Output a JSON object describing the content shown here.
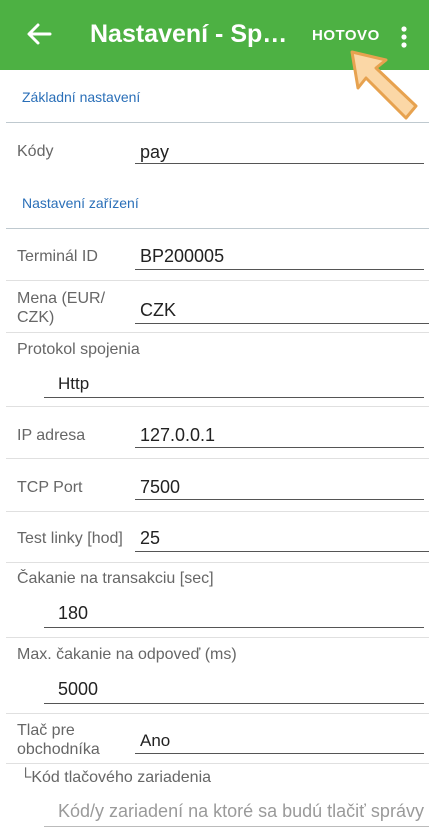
{
  "appbar": {
    "back_icon": "arrow-left-icon",
    "title": "Nastavení - Správ...",
    "done_label": "HOTOVO",
    "more_icon": "more-vertical-icon",
    "color": "#4db143"
  },
  "sections": {
    "basic": "Základní nastavení",
    "device": "Nastavení zařízení"
  },
  "fields": {
    "codes": {
      "label": "Kódy",
      "value": "pay"
    },
    "terminal_id": {
      "label": "Terminál ID",
      "value": "BP200005"
    },
    "currency": {
      "label": "Mena (EUR/\nCZK)",
      "value": "CZK"
    },
    "protocol": {
      "label": "Protokol spojenia",
      "value": "Http"
    },
    "ip": {
      "label": "IP adresa",
      "value": "127.0.0.1"
    },
    "tcp_port": {
      "label": "TCP Port",
      "value": "7500"
    },
    "test_line": {
      "label": "Test linky [hod]",
      "value": "25"
    },
    "tx_wait": {
      "label": "Čakanie na transakciu [sec]",
      "value": "180"
    },
    "max_wait": {
      "label": "Max. čakanie na odpoveď (ms)",
      "value": "5000"
    },
    "merchant_print": {
      "label": "Tlač pre\nobchodníka",
      "value": "Ano"
    },
    "printer_code": {
      "label": "└Kód tlačového zariadenia",
      "placeholder": "Kód/y zariadení na ktoré sa budú tlačiť správy"
    }
  },
  "accent": "#2a6fb8"
}
